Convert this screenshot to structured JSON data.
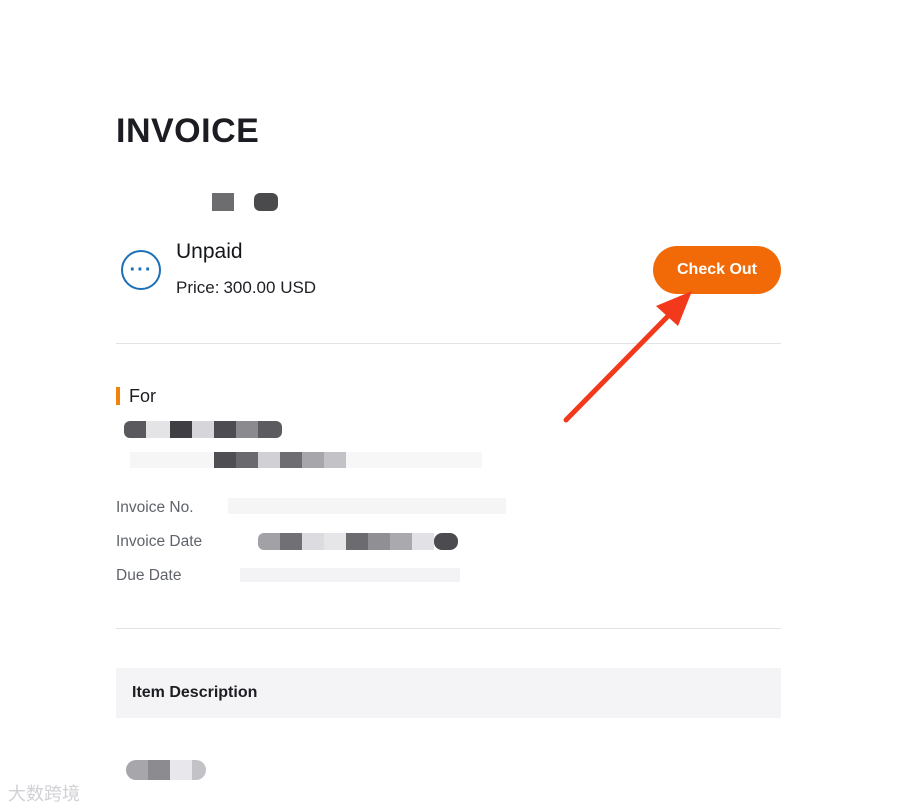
{
  "invoice": {
    "title": "INVOICE"
  },
  "status": {
    "label": "Unpaid",
    "price_label": "Price:",
    "price_value": "300.00 USD",
    "icon": "more-horizontal-circle-icon",
    "icon_glyph": "···"
  },
  "actions": {
    "checkout_label": "Check Out"
  },
  "billing": {
    "for_label": "For"
  },
  "meta": {
    "invoice_no_label": "Invoice No.",
    "invoice_date_label": "Invoice Date",
    "due_date_label": "Due Date"
  },
  "items_table": {
    "header": "Item Description"
  },
  "colors": {
    "accent_orange": "#f26a07",
    "status_blue": "#1d6fb8",
    "annotation_arrow": "#f2391c",
    "section_bar": "#f0830c"
  },
  "watermark": {
    "text": "大数跨境"
  }
}
